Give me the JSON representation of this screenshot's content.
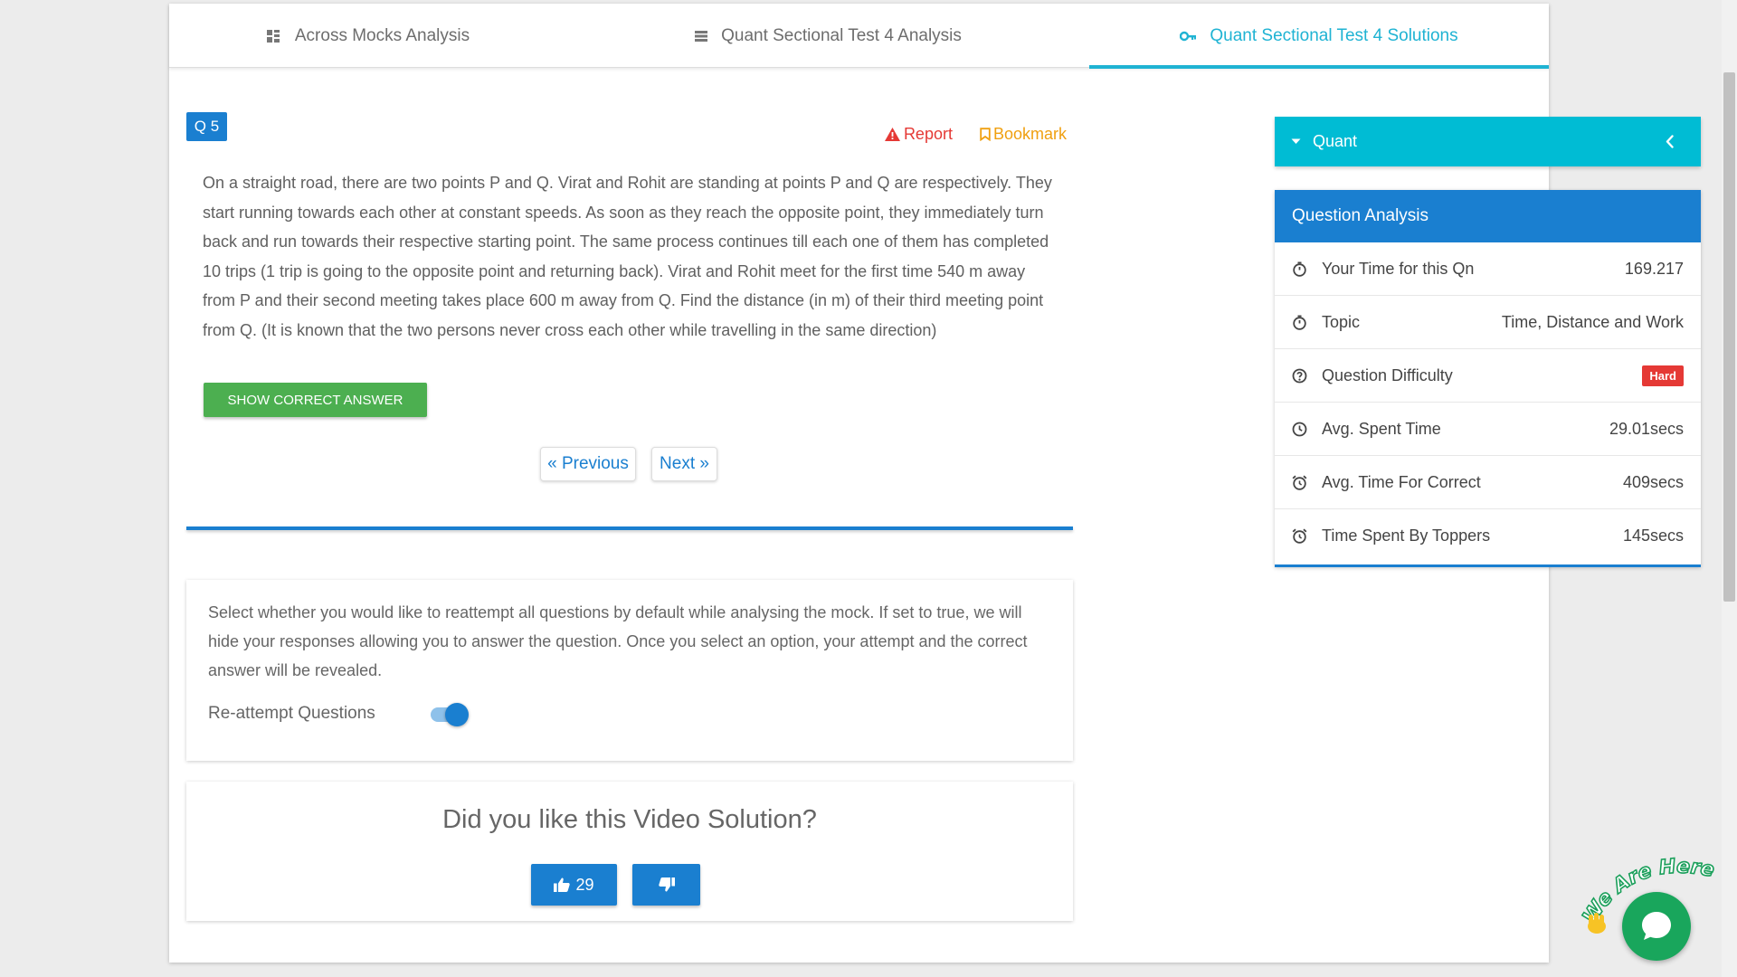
{
  "tabs": [
    {
      "label": "Across Mocks Analysis",
      "icon": "grid-icon"
    },
    {
      "label": "Quant Sectional Test 4 Analysis",
      "icon": "list-icon"
    },
    {
      "label": "Quant Sectional Test 4 Solutions",
      "icon": "key-icon",
      "active": true
    }
  ],
  "question": {
    "number_label": "Q 5",
    "report_label": "Report",
    "bookmark_label": "Bookmark",
    "text": "On a straight road, there are two points P and Q. Virat and Rohit are standing at points P and Q are respectively. They start running towards each other at constant speeds. As soon as they reach the opposite point, they immediately turn back and run towards their respective  starting point. The same process continues till each one of them has completed 10 trips (1 trip is going to the opposite point and returning back). Virat and Rohit meet for the first time 540 m away from P and their second meeting takes place 600 m away from Q. Find the distance (in m) of their third meeting point from Q. (It is known that the two persons never cross each other while travelling in the same direction)",
    "show_answer_label": "SHOW CORRECT ANSWER"
  },
  "pager": {
    "previous_label": "« Previous",
    "next_label": "Next »"
  },
  "reattempt": {
    "description": "Select whether you would like to reattempt all questions by default while analysing the mock. If set to true, we will hide your responses allowing you to answer the question. Once you select an option, your attempt and the correct answer will be revealed.",
    "label": "Re-attempt Questions",
    "enabled": true
  },
  "video_feedback": {
    "title": "Did you like this Video Solution?",
    "likes": "29"
  },
  "sidebar": {
    "section_label": "Quant",
    "analysis_title": "Question Analysis",
    "rows": [
      {
        "label": "Your Time for this Qn",
        "value": "169.217",
        "icon": "stopwatch-icon"
      },
      {
        "label": "Topic",
        "value": "Time, Distance and Work",
        "icon": "stopwatch-icon"
      },
      {
        "label": "Question Difficulty",
        "value": "Hard",
        "icon": "help-circle-icon"
      },
      {
        "label": "Avg. Spent Time",
        "value": "29.01secs",
        "icon": "clock-icon"
      },
      {
        "label": "Avg. Time For Correct",
        "value": "409secs",
        "icon": "alarm-icon"
      },
      {
        "label": "Time Spent By Toppers",
        "value": "145secs",
        "icon": "alarm-icon"
      }
    ]
  },
  "chat": {
    "banner_text": "We Are Here!"
  },
  "colors": {
    "primary": "#1a7fd0",
    "accent": "#1fb3d3",
    "quant_bar": "#00bcd4",
    "success": "#4caf50",
    "danger": "#e53935",
    "warning": "#f0a010",
    "chat": "#19a65c"
  }
}
